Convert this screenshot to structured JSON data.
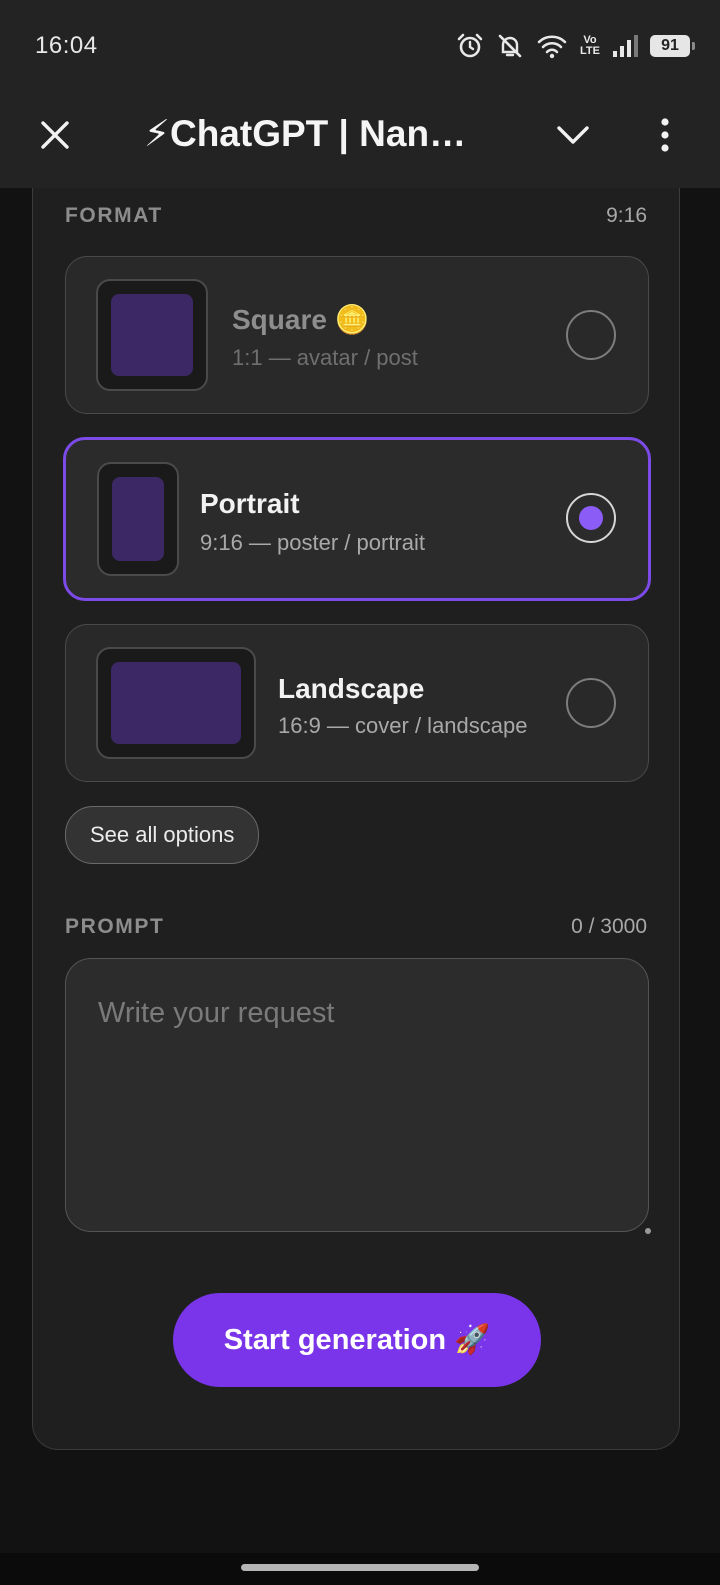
{
  "status_bar": {
    "time": "16:04",
    "network": "Vo LTE",
    "volte_top": "Vo",
    "volte_bottom": "LTE",
    "battery": "91",
    "icons": [
      "alarm-icon",
      "bell-muted-icon",
      "wifi-icon",
      "volte-icon",
      "signal-icon",
      "battery-icon"
    ]
  },
  "header": {
    "title": "⚡ChatGPT | Nan…",
    "icons": [
      "close-icon",
      "chevron-down-icon",
      "more-vertical-icon"
    ]
  },
  "format": {
    "label": "FORMAT",
    "selected_value": "9:16",
    "options": [
      {
        "title": "Square 🪙",
        "subtitle": "1:1 — avatar / post",
        "selected": false
      },
      {
        "title": "Portrait",
        "subtitle": "9:16 — poster / portrait",
        "selected": true
      },
      {
        "title": "Landscape",
        "subtitle": "16:9 — cover / landscape",
        "selected": false
      }
    ],
    "see_all_label": "See all options"
  },
  "prompt": {
    "label": "PROMPT",
    "counter": "0 / 3000",
    "placeholder": "Write your request"
  },
  "actions": {
    "start_label": "Start generation 🚀"
  },
  "colors": {
    "accent": "#7a35ea",
    "radio_fill": "#8b5cf6",
    "selected_border": "#7c4ae6",
    "thumb_fill": "#3d2866"
  }
}
